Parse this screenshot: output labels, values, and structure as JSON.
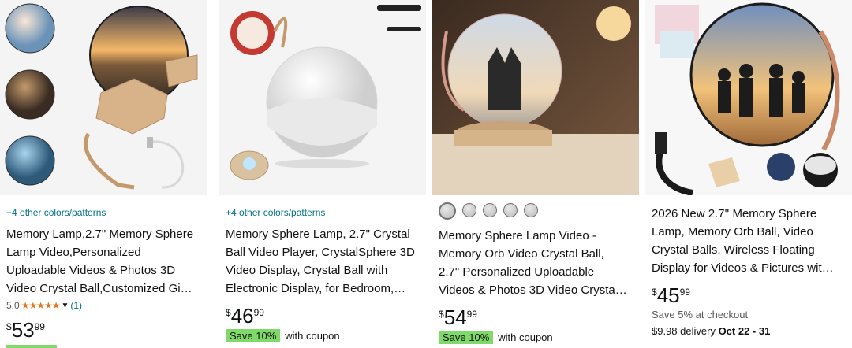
{
  "products": [
    {
      "colors_link": "+4 other colors/patterns",
      "title": "Memory Lamp,2.7\" Memory Sphere Lamp Video,Personalized Uploadable Videos & Photos 3D Video Crystal Ball,Customized Gi…",
      "rating": "5.0",
      "stars": "★★★★★",
      "rating_count": "(1)",
      "price_symbol": "$",
      "price_whole": "53",
      "price_fraction": "99"
    },
    {
      "colors_link": "+4 other colors/patterns",
      "title": "Memory Sphere Lamp, 2.7\" Crystal Ball Video Player, CrystalSphere 3D Video Display, Crystal Ball with Electronic Display, for Bedroom,…",
      "price_symbol": "$",
      "price_whole": "46",
      "price_fraction": "99",
      "coupon_badge": "Save 10%",
      "coupon_text": "with coupon"
    },
    {
      "title": "Memory Sphere Lamp Video - Memory Orb Video Crystal Ball, 2.7\" Personalized Uploadable Videos & Photos 3D Video Crysta…",
      "price_symbol": "$",
      "price_whole": "54",
      "price_fraction": "99",
      "coupon_badge": "Save 10%",
      "coupon_text": "with coupon"
    },
    {
      "title": "2026 New 2.7'' Memory Sphere Lamp, Memory Orb Ball, Video Crystal Balls, Wireless Floating Display for Videos & Pictures wit…",
      "price_symbol": "$",
      "price_whole": "45",
      "price_fraction": "99",
      "checkout_text": "Save 5% at checkout",
      "delivery_prefix": "$9.98 delivery ",
      "delivery_dates": "Oct 22 - 31"
    }
  ]
}
